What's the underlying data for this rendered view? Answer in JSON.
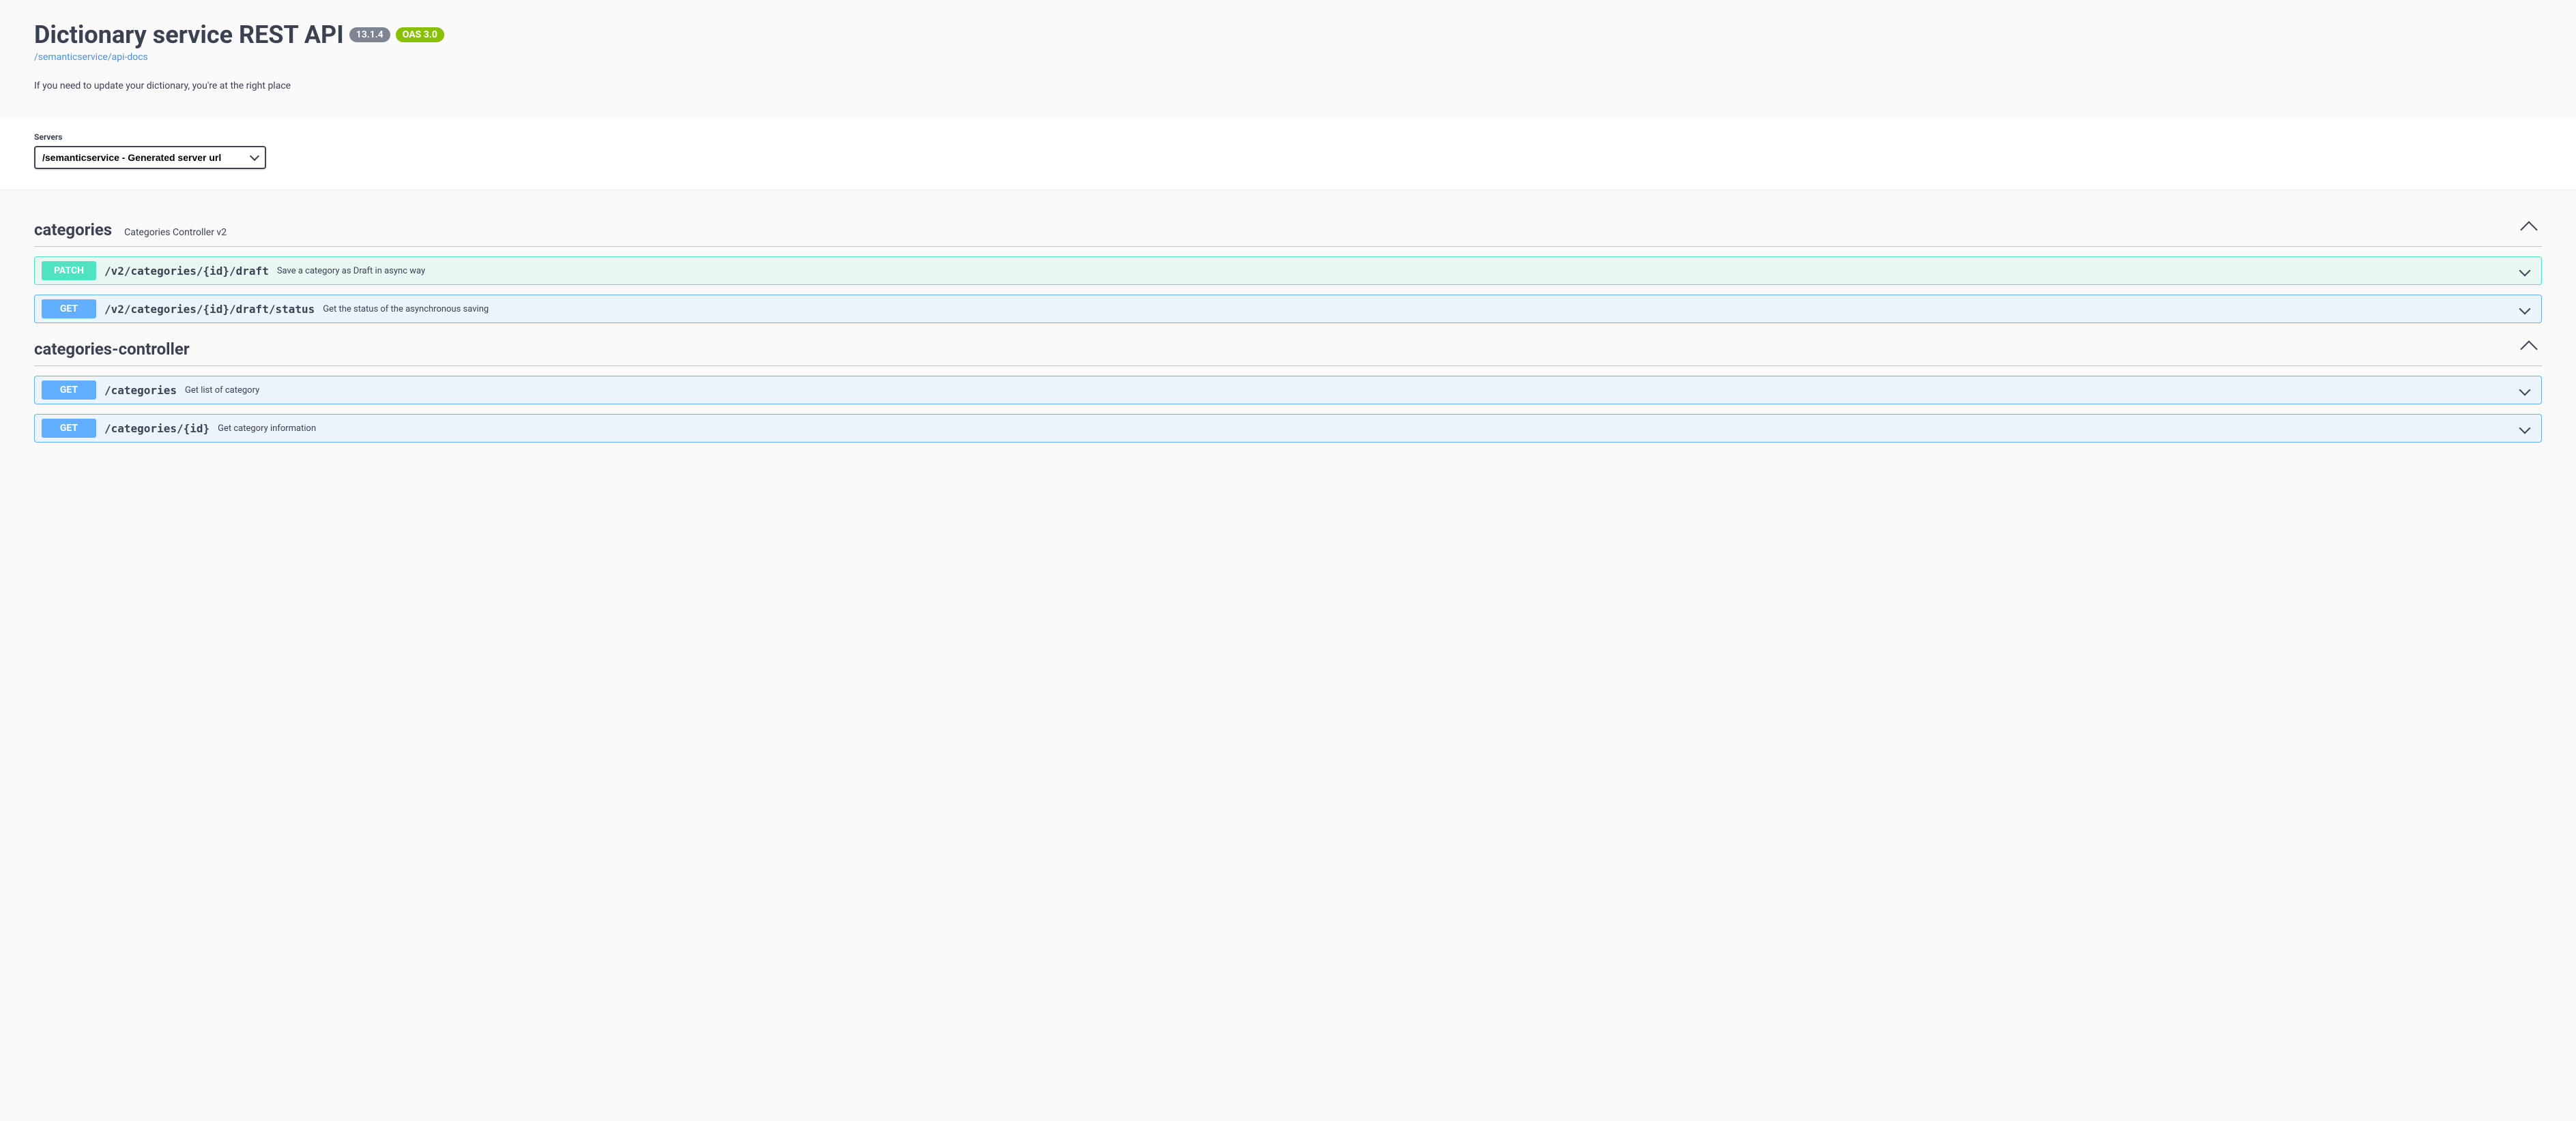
{
  "header": {
    "title": "Dictionary service REST API",
    "version": "13.1.4",
    "oas": "OAS 3.0",
    "docs_link": "/semanticservice/api-docs",
    "description": "If you need to update your dictionary, you're at the right place"
  },
  "servers": {
    "label": "Servers",
    "selected": "/semanticservice - Generated server url"
  },
  "tags": [
    {
      "name": "categories",
      "desc": "Categories Controller v2",
      "operations": [
        {
          "method": "PATCH",
          "path": "/v2/categories/{id}/draft",
          "summary": "Save a category as Draft in async way"
        },
        {
          "method": "GET",
          "path": "/v2/categories/{id}/draft/status",
          "summary": "Get the status of the asynchronous saving"
        }
      ]
    },
    {
      "name": "categories-controller",
      "desc": "",
      "operations": [
        {
          "method": "GET",
          "path": "/categories",
          "summary": "Get list of category"
        },
        {
          "method": "GET",
          "path": "/categories/{id}",
          "summary": "Get category information"
        }
      ]
    }
  ]
}
